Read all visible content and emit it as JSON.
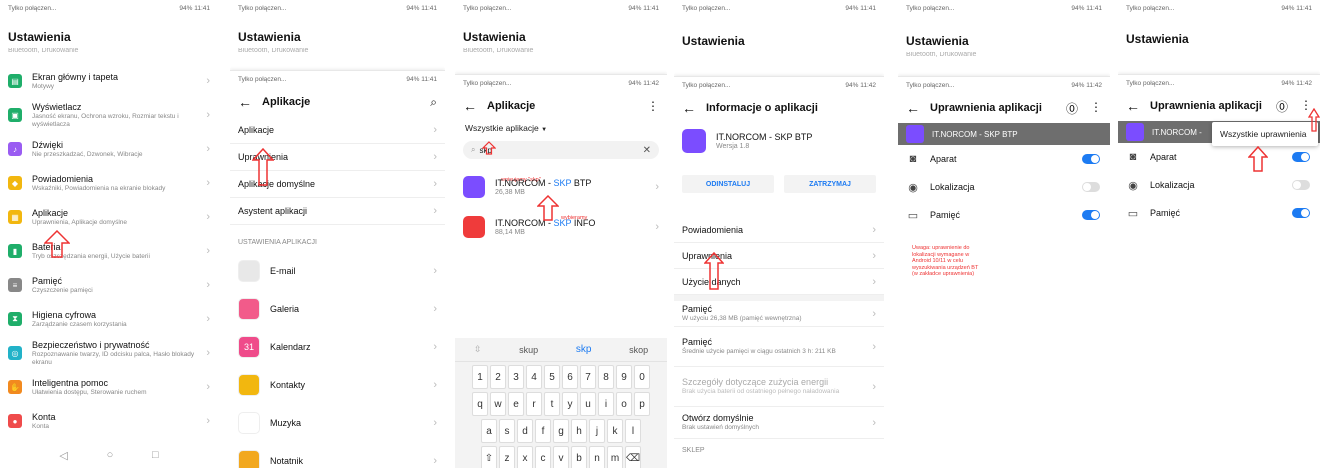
{
  "status": {
    "left": "Tylko połączen...",
    "right": "94% 11:41",
    "right2": "94% 11:42"
  },
  "p1": {
    "title": "Ustawienia",
    "cut": "Bluetooth, Drukowanie",
    "items": [
      {
        "t": "Ekran główny i tapeta",
        "s": "Motywy",
        "c": "#1fae6a",
        "g": "▤"
      },
      {
        "t": "Wyświetlacz",
        "s": "Jasność ekranu, Ochrona wzroku, Rozmiar tekstu i wyświetlacza",
        "c": "#1fae6a",
        "g": "▣"
      },
      {
        "t": "Dźwięki",
        "s": "Nie przeszkadzać, Dzwonek, Wibracje",
        "c": "#9a5cf2",
        "g": "♪"
      },
      {
        "t": "Powiadomienia",
        "s": "Wskaźniki, Powiadomienia na ekranie blokady",
        "c": "#f2b70f",
        "g": "◆"
      },
      {
        "t": "Aplikacje",
        "s": "Uprawnienia, Aplikacje domyślne",
        "c": "#f2b70f",
        "g": "▦"
      },
      {
        "t": "Bateria",
        "s": "Tryb oszczędzania energii, Użycie baterii",
        "c": "#1fae6a",
        "g": "▮"
      },
      {
        "t": "Pamięć",
        "s": "Czyszczenie pamięci",
        "c": "#888",
        "g": "≡"
      },
      {
        "t": "Higiena cyfrowa",
        "s": "Zarządzanie czasem korzystania",
        "c": "#1fae6a",
        "g": "⧗"
      },
      {
        "t": "Bezpieczeństwo i prywatność",
        "s": "Rozpoznawanie twarzy, ID odcisku palca, Hasło blokady ekranu",
        "c": "#22b2c8",
        "g": "◎"
      },
      {
        "t": "Inteligentna pomoc",
        "s": "Ułatwienia dostępu, Sterowanie ruchem",
        "c": "#f28a1f",
        "g": "✋"
      },
      {
        "t": "Konta",
        "s": "Konta",
        "c": "#ef4b4b",
        "g": "●"
      }
    ],
    "nav": [
      "◁",
      "○",
      "□"
    ]
  },
  "p2": {
    "title": "Ustawienia",
    "cut": "Bluetooth, Drukowanie",
    "header": "Aplikacje",
    "items": [
      "Aplikacje",
      "Uprawnienia",
      "Aplikacje domyślne",
      "Asystent aplikacji"
    ],
    "section": "USTAWIENIA APLIKACJI",
    "apps": [
      {
        "n": "E-mail",
        "c": "#e8e8e8"
      },
      {
        "n": "Galeria",
        "c": "#f25b8a"
      },
      {
        "n": "Kalendarz",
        "c": "#ef4b8a",
        "g": "31"
      },
      {
        "n": "Kontakty",
        "c": "#f2b70f"
      },
      {
        "n": "Muzyka",
        "c": "#ffffff"
      },
      {
        "n": "Notatnik",
        "c": "#f2a81f"
      }
    ]
  },
  "p3": {
    "title": "Ustawienia",
    "cut": "Bluetooth, Drukowanie",
    "header": "Aplikacje",
    "filter": "Wszystkie aplikacje",
    "search": "skp",
    "note1": "wpisujemy \"skp\"",
    "note2": "wybieramy",
    "apps": [
      {
        "pre": "IT.NORCOM - ",
        "hl": "SKP",
        "post": " BTP",
        "size": "26,38 MB",
        "c": "#7b4dff"
      },
      {
        "pre": "IT.NORCOM - ",
        "hl": "SKP",
        "post": " INFO",
        "size": "88,14 MB",
        "c": "#ef3b3b"
      }
    ],
    "kb": {
      "sug": [
        "skup",
        "skp",
        "skop"
      ],
      "r1": [
        "1",
        "2",
        "3",
        "4",
        "5",
        "6",
        "7",
        "8",
        "9",
        "0"
      ],
      "r2": [
        "q",
        "w",
        "e",
        "r",
        "t",
        "y",
        "u",
        "i",
        "o",
        "p"
      ],
      "r3": [
        "a",
        "s",
        "d",
        "f",
        "g",
        "h",
        "j",
        "k",
        "l"
      ],
      "r4": [
        "⇧",
        "z",
        "x",
        "c",
        "v",
        "b",
        "n",
        "m",
        "⌫"
      ]
    }
  },
  "p4": {
    "title": "Ustawienia",
    "header": "Informacje o aplikacji",
    "app": "IT.NORCOM - SKP BTP",
    "ver": "Wersja 1.8",
    "b1": "ODINSTALUJ",
    "b2": "ZATRZYMAJ",
    "items": [
      {
        "t": "Powiadomienia",
        "s": ""
      },
      {
        "t": "Uprawnienia",
        "s": ""
      },
      {
        "t": "Użycie danych",
        "s": ""
      },
      {
        "t": "Pamięć",
        "s": "W użyciu 26,38 MB (pamięć wewnętrzna)"
      },
      {
        "t": "Pamięć",
        "s": "Średnie użycie pamięci w ciągu ostatnich 3 h: 211 KB"
      },
      {
        "t": "Szczegóły dotyczące zużycia energii",
        "s": "Brak użycia baterii od ostatniego pełnego naładowania",
        "dim": true
      },
      {
        "t": "Otwórz domyślnie",
        "s": "Brak ustawień domyślnych"
      }
    ],
    "section": "SKLEP"
  },
  "p5": {
    "title": "Ustawienia",
    "cut": "Bluetooth, Drukowanie",
    "header": "Uprawnienia aplikacji",
    "app": "IT.NORCOM - SKP BTP",
    "perms": [
      {
        "n": "Aparat",
        "on": true,
        "g": "◙"
      },
      {
        "n": "Lokalizacja",
        "on": false,
        "g": "◉"
      },
      {
        "n": "Pamięć",
        "on": true,
        "g": "▭"
      }
    ],
    "note": "Uwaga: uprawnienie do lokalizacji wymagane w Android 10/11 w celu wyszukiwania urządzeń BT (w zakładce uprawnienia)"
  },
  "p6": {
    "title": "Ustawienia",
    "header": "Uprawnienia aplikacji",
    "app": "IT.NORCOM - ",
    "menu": "Wszystkie uprawnienia",
    "perms": [
      {
        "n": "Aparat",
        "on": true,
        "g": "◙"
      },
      {
        "n": "Lokalizacja",
        "on": false,
        "g": "◉"
      },
      {
        "n": "Pamięć",
        "on": true,
        "g": "▭"
      }
    ]
  },
  "colors": {
    "accent": "#1d7bf2",
    "arrow": "#e33"
  }
}
